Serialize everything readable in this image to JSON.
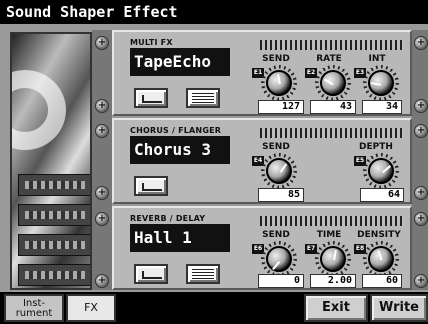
{
  "title": "Sound Shaper Effect",
  "multi_fx": {
    "section_label": "MULTI FX",
    "name": "TapeEcho",
    "params": [
      {
        "label": "SEND",
        "badge": "E1",
        "value": "127"
      },
      {
        "label": "RATE",
        "badge": "E2",
        "value": "43"
      },
      {
        "label": "INT",
        "badge": "E3",
        "value": "34"
      }
    ]
  },
  "chorus": {
    "section_label": "CHORUS / FLANGER",
    "name": "Chorus 3",
    "params": [
      {
        "label": "SEND",
        "badge": "E4",
        "value": "85"
      },
      {
        "label": "DEPTH",
        "badge": "E5",
        "value": "64"
      }
    ]
  },
  "reverb": {
    "section_label": "REVERB / DELAY",
    "name": "Hall 1",
    "params": [
      {
        "label": "SEND",
        "badge": "E6",
        "value": "0"
      },
      {
        "label": "TIME",
        "badge": "E7",
        "value": "2.00"
      },
      {
        "label": "DENSITY",
        "badge": "E8",
        "value": "60"
      }
    ]
  },
  "tabs": {
    "instrument": "Inst-\nrument",
    "fx": "FX"
  },
  "buttons": {
    "exit": "Exit",
    "write": "Write"
  }
}
